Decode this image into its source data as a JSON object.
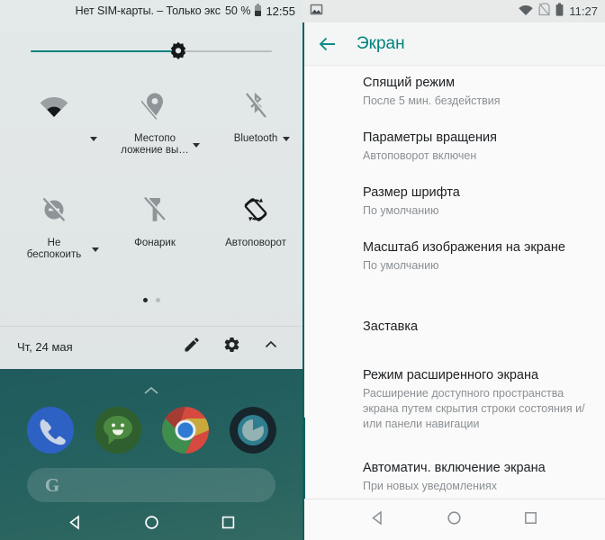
{
  "left_panel": {
    "status_bar": {
      "carrier_text": "Нет SIM-карты. – Только экс",
      "battery_percent": "50 %",
      "clock": "12:55",
      "battery_icon": "battery-half-icon"
    },
    "brightness": {
      "icon": "brightness-sun-icon",
      "value_percent": 62
    },
    "tiles": [
      {
        "label": "",
        "icon": "wifi-icon",
        "has_caret": true,
        "state": "on"
      },
      {
        "label": "Местопо\nложение вы…",
        "icon": "location-off-icon",
        "has_caret": true,
        "state": "off"
      },
      {
        "label": "Bluetooth",
        "icon": "bluetooth-off-icon",
        "has_caret": true,
        "state": "off"
      },
      {
        "label": "Не\nбеспокоить",
        "icon": "do-not-disturb-off-icon",
        "has_caret": true,
        "state": "off"
      },
      {
        "label": "Фонарик",
        "icon": "flashlight-off-icon",
        "has_caret": false,
        "state": "off"
      },
      {
        "label": "Автоповорот",
        "icon": "auto-rotate-icon",
        "has_caret": false,
        "state": "on"
      }
    ],
    "page_dots": {
      "count": 2,
      "active_index": 0
    },
    "footer": {
      "date": "Чт, 24 мая",
      "edit_icon": "pencil-icon",
      "settings_icon": "gear-icon",
      "collapse_icon": "chevron-up-icon"
    },
    "home": {
      "expand_icon": "chevron-up-icon",
      "dock_apps": [
        {
          "name": "phone-app-icon",
          "color": "#2d62c4"
        },
        {
          "name": "messages-app-icon",
          "color": "#376e35"
        },
        {
          "name": "chrome-app-icon",
          "color": "#3e8de3"
        },
        {
          "name": "camera-app-icon",
          "color": "#1c3036"
        }
      ],
      "search_widget": {
        "icon": "google-g-icon",
        "label": "G"
      },
      "nav": [
        "back-button",
        "home-button",
        "recents-button"
      ]
    }
  },
  "right_panel": {
    "status_bar": {
      "notification_icon": "screenshot-icon",
      "icons": [
        "wifi-icon",
        "no-sim-icon",
        "battery-icon"
      ],
      "clock": "11:27"
    },
    "app_bar": {
      "back_icon": "arrow-back-icon",
      "title": "Экран"
    },
    "settings_items": [
      {
        "title": "Спящий режим",
        "subtitle": "После 5 мин. бездействия"
      },
      {
        "title": "Параметры вращения",
        "subtitle": "Автоповорот включен"
      },
      {
        "title": "Размер шрифта",
        "subtitle": "По умолчанию"
      },
      {
        "title": "Масштаб изображения на экране",
        "subtitle": "По умолчанию"
      },
      {
        "title": "Заставка",
        "subtitle": ""
      },
      {
        "title": "Режим расширенного экрана",
        "subtitle": "Расширение доступного пространства экрана путем скрытия строки состояния и/или панели навигации"
      },
      {
        "title": "Автоматич. включение экрана",
        "subtitle": "При новых уведомлениях"
      }
    ],
    "nav": [
      "back-button",
      "home-button",
      "recents-button"
    ]
  },
  "theme": {
    "accent_teal": "#00837d",
    "qs_background": "#e2e7e7",
    "list_background": "#fafafa",
    "wallpaper_teal": "#23605f"
  }
}
